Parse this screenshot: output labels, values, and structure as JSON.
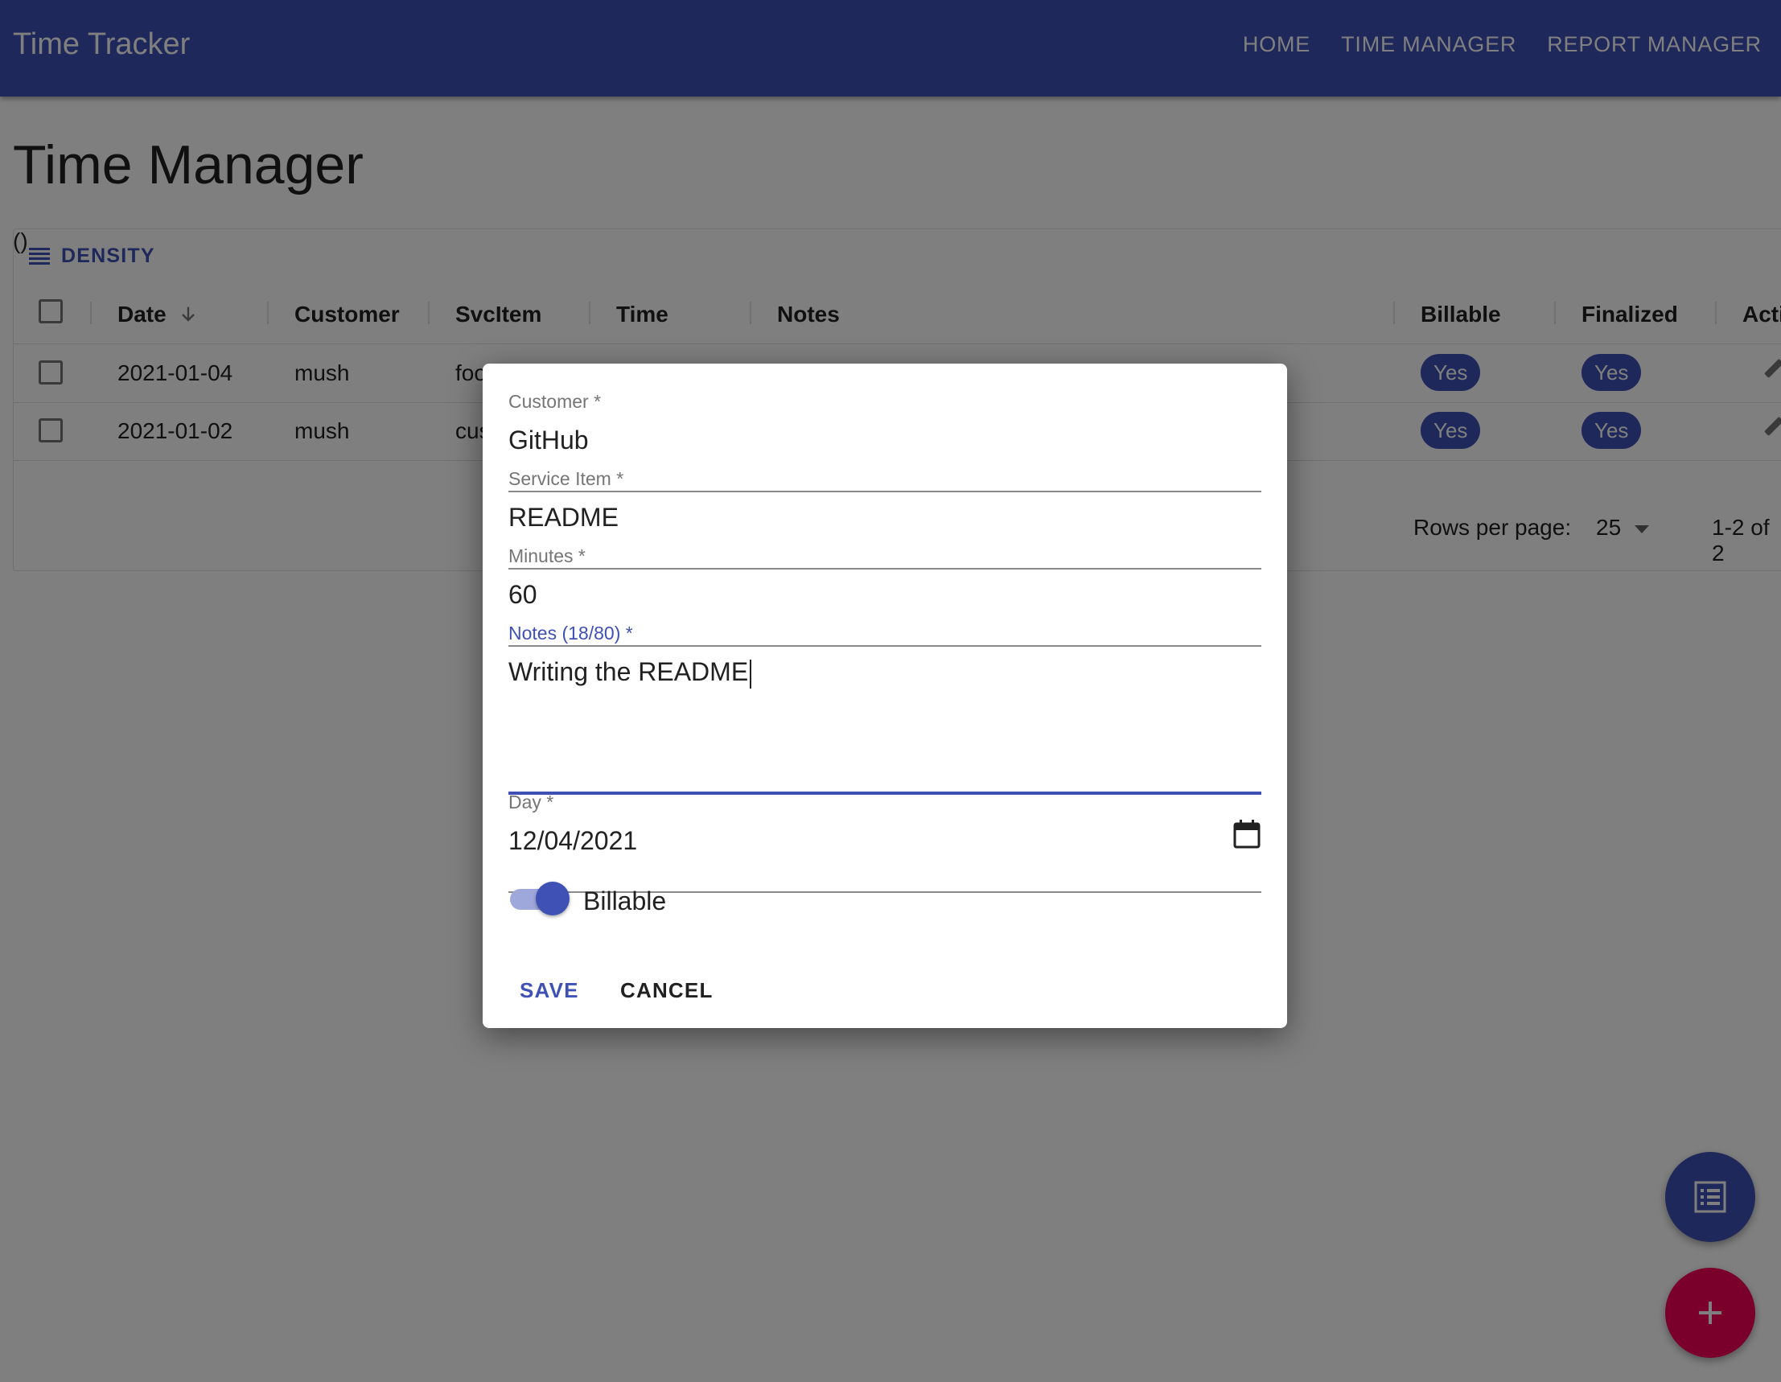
{
  "app": {
    "title": "Time Tracker",
    "nav": [
      "HOME",
      "TIME MANAGER",
      "REPORT MANAGER"
    ]
  },
  "page": {
    "title": "Time Manager",
    "parens": "()",
    "density_label": "DENSITY"
  },
  "table": {
    "columns": [
      "Date",
      "Customer",
      "SvcItem",
      "Time",
      "Notes",
      "Billable",
      "Finalized",
      "Acti"
    ],
    "rows": [
      {
        "date": "2021-01-04",
        "customer": "mush",
        "svcitem": "foo",
        "billable": "Yes",
        "finalized": "Yes"
      },
      {
        "date": "2021-01-02",
        "customer": "mush",
        "svcitem": "cus",
        "billable": "Yes",
        "finalized": "Yes"
      }
    ],
    "pager": {
      "rows_per_page_label": "Rows per page:",
      "rows_per_page": "25",
      "range": "1-2 of 2"
    }
  },
  "dialog": {
    "customer": {
      "label": "Customer *",
      "value": "GitHub"
    },
    "service_item": {
      "label": "Service Item *",
      "value": "README"
    },
    "minutes": {
      "label": "Minutes *",
      "value": "60"
    },
    "notes": {
      "label": "Notes (18/80) *",
      "value": "Writing the README"
    },
    "day": {
      "label": "Day *",
      "value": "12/04/2021"
    },
    "billable": {
      "label": "Billable",
      "checked": true
    },
    "save_label": "SAVE",
    "cancel_label": "CANCEL"
  },
  "icons": {
    "density": "density-icon",
    "sort": "arrow-down-icon",
    "calendar": "calendar-icon",
    "list_fab": "list-icon",
    "add_fab": "plus-icon",
    "edit": "pencil-icon"
  },
  "colors": {
    "primary": "#3f51b5",
    "secondary": "#f50057",
    "switch_track": "#9fa8da"
  }
}
